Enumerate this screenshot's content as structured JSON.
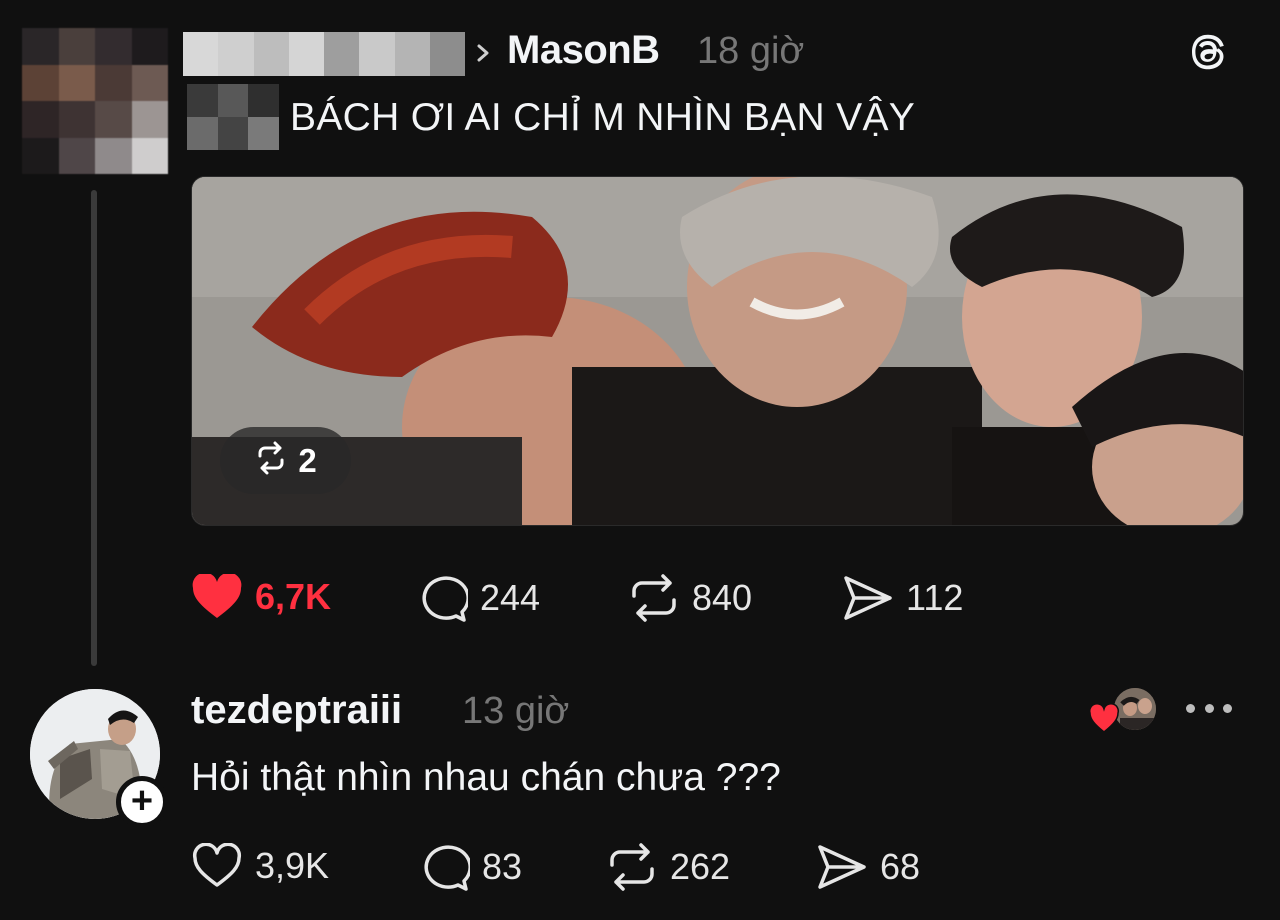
{
  "post": {
    "author": "MasonB",
    "time": "18 giờ",
    "text": "BÁCH ƠI AI CHỈ M NHÌN BẠN VẬY",
    "media": {
      "repost_count": "2"
    },
    "actions": {
      "likes": "6,7K",
      "comments": "244",
      "reposts": "840",
      "shares": "112"
    },
    "liked": true
  },
  "reply": {
    "author": "tezdeptraiii",
    "time": "13 giờ",
    "text": "Hỏi thật nhìn nhau chán chưa ???",
    "actions": {
      "likes": "3,9K",
      "comments": "83",
      "reposts": "262",
      "shares": "68"
    },
    "liked": false
  },
  "icons": {
    "logo": "threads-logo-icon",
    "heart": "heart-icon",
    "comment": "comment-icon",
    "repost": "repost-icon",
    "share": "send-icon",
    "more": "more-icon",
    "follow": "plus-icon",
    "chevron": "chevron-right-icon"
  },
  "colors": {
    "background": "#101010",
    "text": "#f3f5f7",
    "muted": "#777777",
    "like": "#ff3040"
  }
}
